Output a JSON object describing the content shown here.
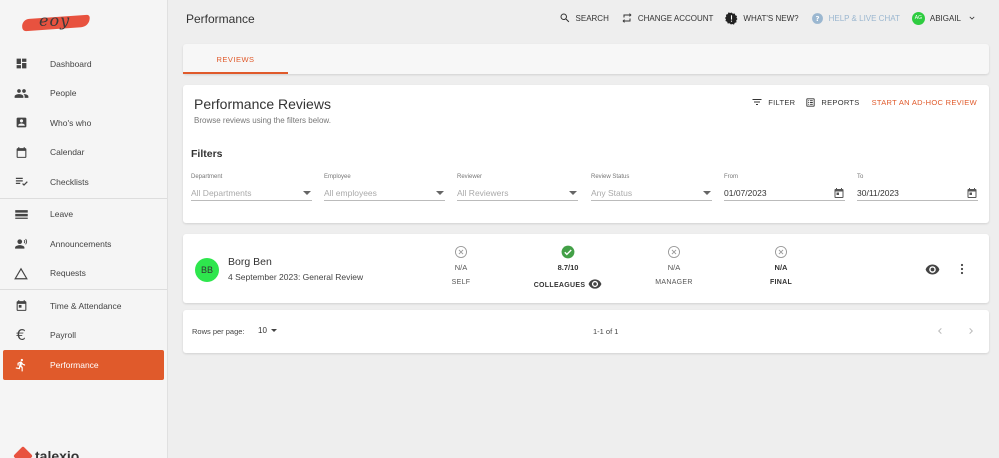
{
  "app": {
    "logo_text": "eoy",
    "footer_brand": "talexio"
  },
  "sidebar": {
    "items": [
      {
        "label": "Dashboard",
        "icon": "dashboard-icon"
      },
      {
        "label": "People",
        "icon": "people-icon"
      },
      {
        "label": "Who's who",
        "icon": "contact-card-icon"
      },
      {
        "label": "Calendar",
        "icon": "calendar-icon"
      },
      {
        "label": "Checklists",
        "icon": "checklist-icon"
      },
      {
        "label": "Leave",
        "icon": "leave-icon"
      },
      {
        "label": "Announcements",
        "icon": "announcement-icon"
      },
      {
        "label": "Requests",
        "icon": "triangle-icon"
      },
      {
        "label": "Time & Attendance",
        "icon": "calendar-clock-icon"
      },
      {
        "label": "Payroll",
        "icon": "euro-icon"
      },
      {
        "label": "Performance",
        "icon": "running-icon",
        "active": true
      }
    ]
  },
  "header": {
    "title": "Performance",
    "search_label": "SEARCH",
    "change_account_label": "CHANGE ACCOUNT",
    "whats_new_label": "WHAT'S NEW?",
    "help_label": "HELP & LIVE CHAT",
    "user_initials": "AG",
    "user_name": "ABIGAIL"
  },
  "tabs": [
    {
      "label": "REVIEWS",
      "active": true
    }
  ],
  "reviews": {
    "title": "Performance Reviews",
    "subtitle": "Browse reviews using the filters below.",
    "filter_label": "FILTER",
    "reports_label": "REPORTS",
    "adhoc_label": "START AN AD-HOC REVIEW",
    "filters_title": "Filters",
    "filters": {
      "department": {
        "label": "Department",
        "value": "All Departments"
      },
      "employee": {
        "label": "Employee",
        "value": "All employees"
      },
      "reviewer": {
        "label": "Reviewer",
        "value": "All Reviewers"
      },
      "status": {
        "label": "Review Status",
        "value": "Any Status"
      },
      "from": {
        "label": "From",
        "value": "01/07/2023"
      },
      "to": {
        "label": "To",
        "value": "30/11/2023"
      }
    }
  },
  "review_rows": [
    {
      "initials": "BB",
      "name": "Borg Ben",
      "description": "4 September 2023: General Review",
      "self": {
        "value": "N/A",
        "label": "SELF",
        "status": "not-applicable"
      },
      "colleagues": {
        "value": "8.7/10",
        "label": "COLLEAGUES",
        "status": "complete"
      },
      "manager": {
        "value": "N/A",
        "label": "MANAGER",
        "status": "not-applicable"
      },
      "final": {
        "value": "N/A",
        "label": "FINAL",
        "status": "not-applicable"
      }
    }
  ],
  "pagination": {
    "rows_per_page_label": "Rows per page:",
    "rows_per_page": "10",
    "range": "1-1 of 1"
  },
  "colors": {
    "accent": "#e05a2b",
    "success": "#43a047",
    "avatar_green": "#2ee64d"
  }
}
